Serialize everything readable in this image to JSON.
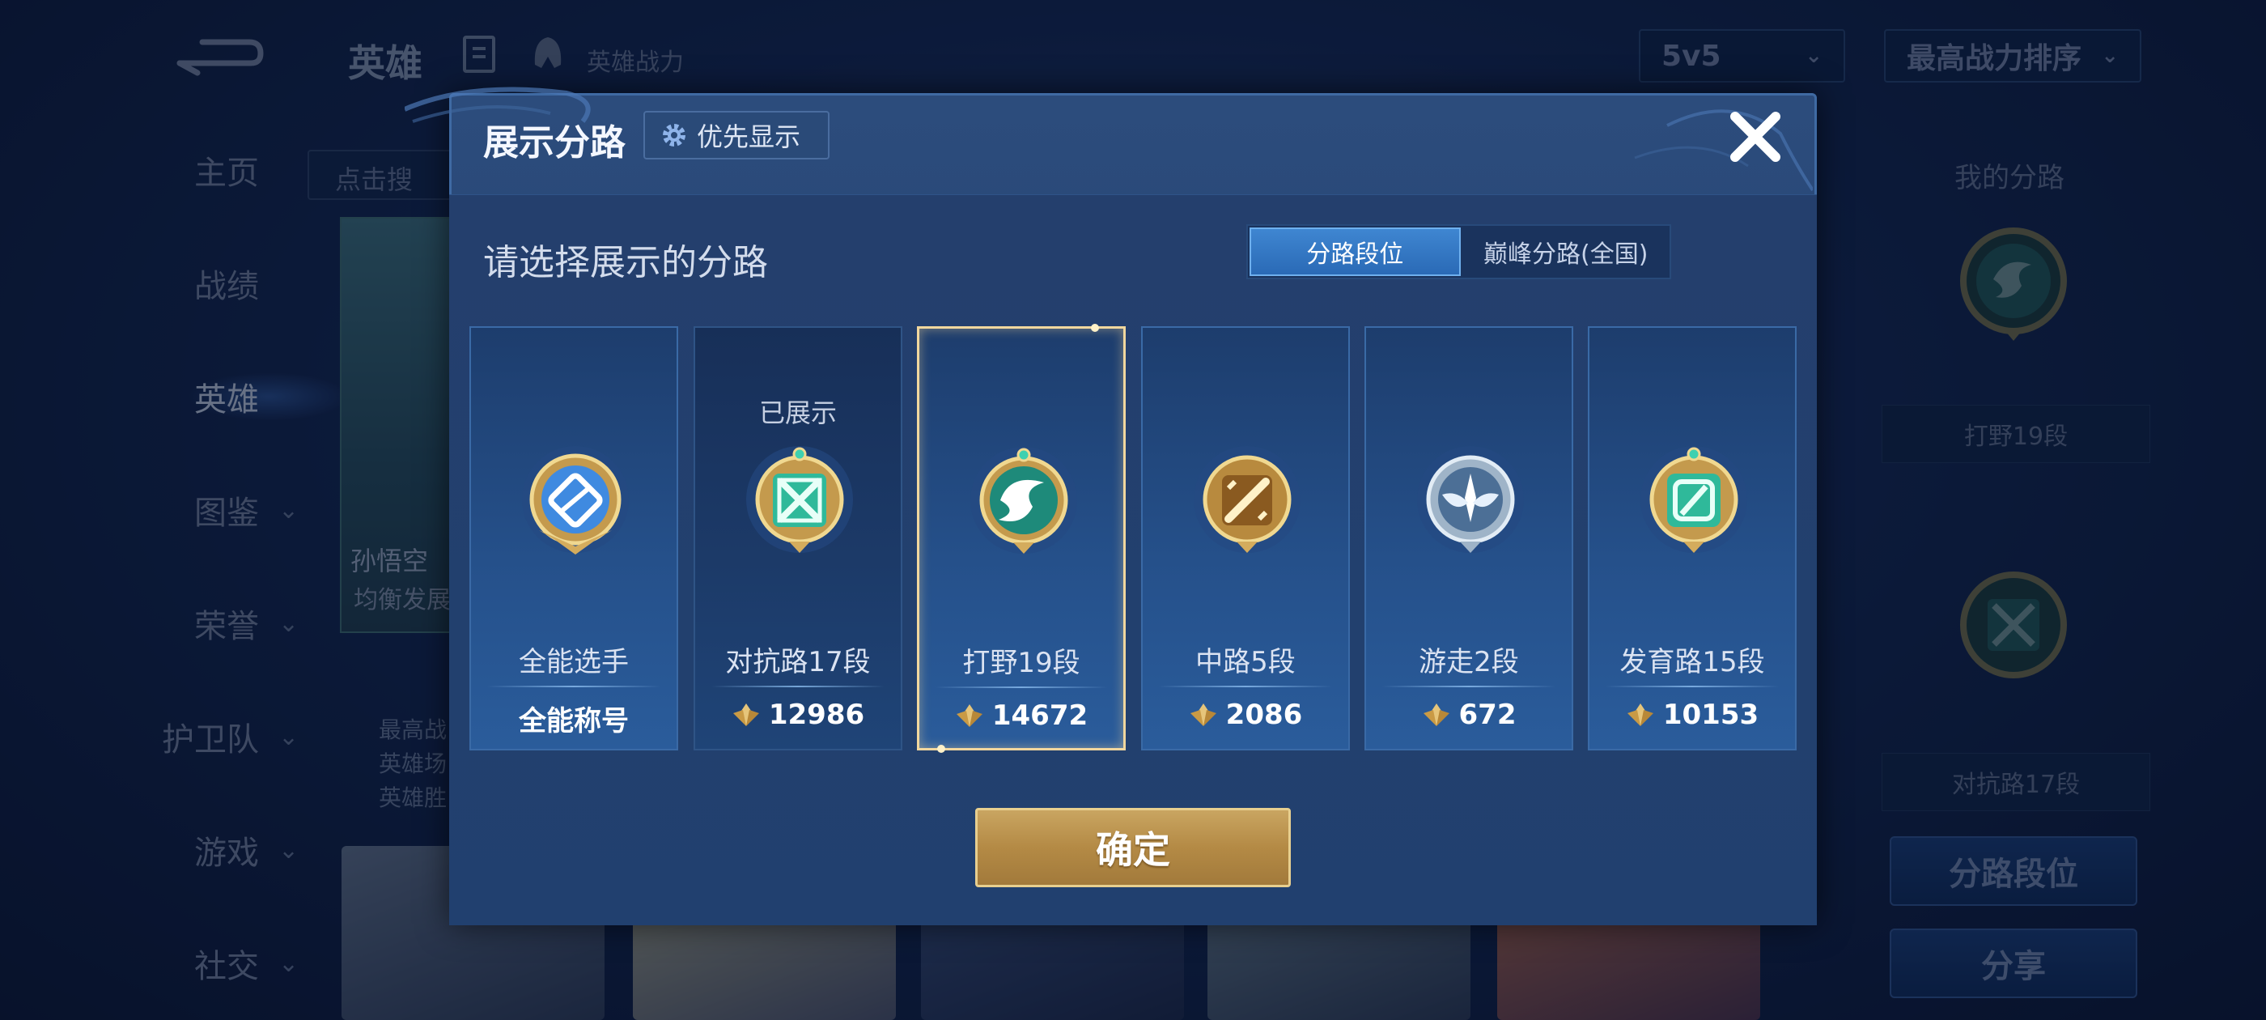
{
  "background": {
    "top_title": "英雄",
    "power_label": "英雄战力",
    "mode_select": "5v5",
    "sort_select": "最高战力排序",
    "nav": [
      {
        "label": "主页",
        "has_arrow": false
      },
      {
        "label": "战绩",
        "has_arrow": false
      },
      {
        "label": "英雄",
        "has_arrow": false
      },
      {
        "label": "图鉴",
        "has_arrow": true
      },
      {
        "label": "荣誉",
        "has_arrow": true
      },
      {
        "label": "护卫队",
        "has_arrow": true
      },
      {
        "label": "游戏",
        "has_arrow": true
      },
      {
        "label": "社交",
        "has_arrow": true
      }
    ],
    "search_placeholder": "点击搜",
    "hero_name": "孙悟空",
    "hero_subtitle": "均衡发展",
    "stats": [
      "最高战",
      "英雄场",
      "英雄胜"
    ],
    "side": {
      "title": "我的分路",
      "label1": "打野19段",
      "label2": "对抗路17段",
      "button1": "分路段位",
      "button2": "分享"
    }
  },
  "modal": {
    "title": "展示分路",
    "priority_button": "优先显示",
    "prompt": "请选择展示的分路",
    "tabs": [
      {
        "label": "分路段位",
        "active": true
      },
      {
        "label": "巅峰分路(全国)",
        "active": false
      }
    ],
    "cards": [
      {
        "rank": "全能选手",
        "score": "全能称号",
        "shown_label": "",
        "selected": false,
        "emblem": "allround-emblem-icon"
      },
      {
        "rank": "对抗路17段",
        "score": "12986",
        "shown_label": "已展示",
        "selected": false,
        "emblem": "clash-lane-emblem-icon"
      },
      {
        "rank": "打野19段",
        "score": "14672",
        "shown_label": "",
        "selected": true,
        "emblem": "jungle-emblem-icon"
      },
      {
        "rank": "中路5段",
        "score": "2086",
        "shown_label": "",
        "selected": false,
        "emblem": "mid-lane-emblem-icon"
      },
      {
        "rank": "游走2段",
        "score": "672",
        "shown_label": "",
        "selected": false,
        "emblem": "roam-emblem-icon"
      },
      {
        "rank": "发育路15段",
        "score": "10153",
        "shown_label": "",
        "selected": false,
        "emblem": "farm-lane-emblem-icon"
      }
    ],
    "confirm_button": "确定"
  },
  "colors": {
    "accent_blue": "#2a6ab6",
    "gold": "#c9a561",
    "selected_border": "#f1d79e"
  }
}
